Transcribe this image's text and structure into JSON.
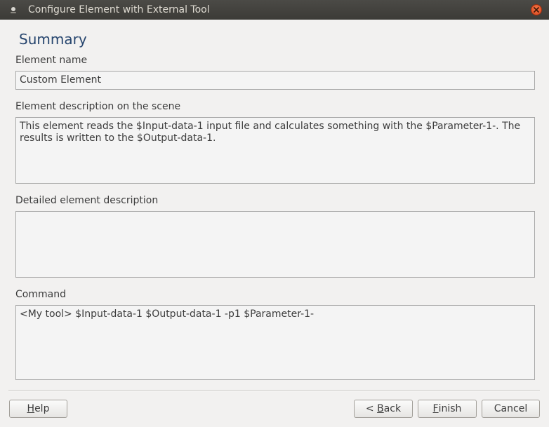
{
  "window": {
    "title": "Configure Element with External Tool"
  },
  "page": {
    "heading": "Summary"
  },
  "element_name": {
    "label": "Element name",
    "value": "Custom Element"
  },
  "scene_description": {
    "label": "Element description on the scene",
    "value": "This element reads the $Input-data-1 input file and calculates something with the $Parameter-1-. The results is written to the $Output-data-1."
  },
  "detailed_description": {
    "label": "Detailed element description",
    "value": ""
  },
  "command": {
    "label": "Command",
    "value": "<My tool> $Input-data-1 $Output-data-1 -p1 $Parameter-1-"
  },
  "buttons": {
    "help": {
      "mnemonic": "H",
      "rest": "elp"
    },
    "back": {
      "prefix": "< ",
      "mnemonic": "B",
      "rest": "ack"
    },
    "finish": {
      "mnemonic": "F",
      "rest": "inish"
    },
    "cancel": {
      "label": "Cancel"
    }
  },
  "icons": {
    "app": "app-dot-icon",
    "close": "close-icon"
  },
  "colors": {
    "heading": "#26456e",
    "close_button": "#e05a2a",
    "titlebar": "#3c3b37"
  }
}
